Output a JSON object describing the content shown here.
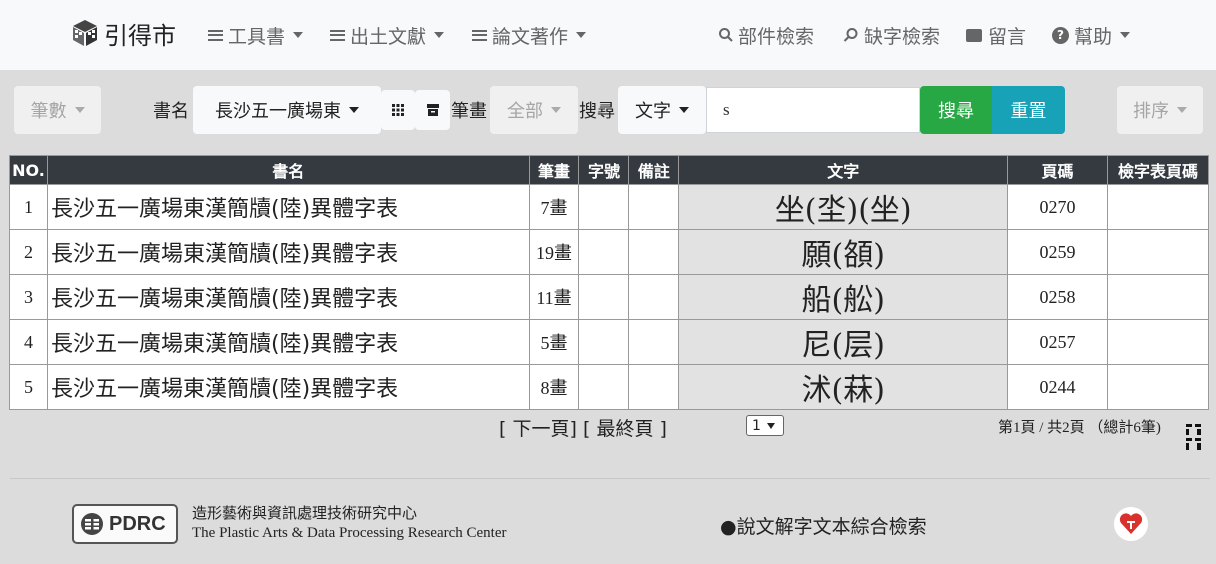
{
  "nav": {
    "brand": "引得市",
    "items": [
      {
        "label": "工具書"
      },
      {
        "label": "出土文獻"
      },
      {
        "label": "論文著作"
      }
    ],
    "part_search": "部件檢索",
    "missing_search": "缺字檢索",
    "message": "留言",
    "help": "幫助"
  },
  "toolbar": {
    "strokes_btn": "筆數",
    "book_label": "書名",
    "book_value": "長沙五一廣場東",
    "strokes_label": "筆畫",
    "strokes_value": "全部",
    "search_label": "搜尋",
    "search_type": "文字",
    "search_value": "s",
    "search_btn": "搜尋",
    "reset_btn": "重置",
    "sort_btn": "排序"
  },
  "table": {
    "headers": [
      "NO.",
      "書名",
      "筆畫",
      "字號",
      "備註",
      "文字",
      "頁碼",
      "檢字表頁碼"
    ],
    "rows": [
      {
        "no": "1",
        "book": "長沙五一廣場東漢簡牘(陸)異體字表",
        "strokes": "7畫",
        "num": "",
        "note": "",
        "glyph": "坐(坔)(坐)",
        "page": "0270",
        "index_page": ""
      },
      {
        "no": "2",
        "book": "長沙五一廣場東漢簡牘(陸)異體字表",
        "strokes": "19畫",
        "num": "",
        "note": "",
        "glyph": "願(頟)",
        "page": "0259",
        "index_page": ""
      },
      {
        "no": "3",
        "book": "長沙五一廣場東漢簡牘(陸)異體字表",
        "strokes": "11畫",
        "num": "",
        "note": "",
        "glyph": "船(舩)",
        "page": "0258",
        "index_page": ""
      },
      {
        "no": "4",
        "book": "長沙五一廣場東漢簡牘(陸)異體字表",
        "strokes": "5畫",
        "num": "",
        "note": "",
        "glyph": "尼(层)",
        "page": "0257",
        "index_page": ""
      },
      {
        "no": "5",
        "book": "長沙五一廣場東漢簡牘(陸)異體字表",
        "strokes": "8畫",
        "num": "",
        "note": "",
        "glyph": "沭(菻)",
        "page": "0244",
        "index_page": ""
      }
    ]
  },
  "pager": {
    "next": "[ 下一頁]",
    "last": "[ 最終頁 ]",
    "page_select": "1",
    "info": "第1頁 / 共2頁 （總計6筆)"
  },
  "footer": {
    "logo_text": "PDRC",
    "org_zh": "造形藝術與資訊處理技術研究中心",
    "org_en": "The Plastic Arts & Data Processing Research Center",
    "link": "●說文解字文本綜合檢索"
  },
  "colors": {
    "navbar_bg": "#f8f9fa",
    "page_bg": "#dcdcdc",
    "table_header": "#343a40",
    "search_btn": "#28a745",
    "reset_btn": "#17a2b8",
    "glyph_cell": "#e2e2e2"
  }
}
